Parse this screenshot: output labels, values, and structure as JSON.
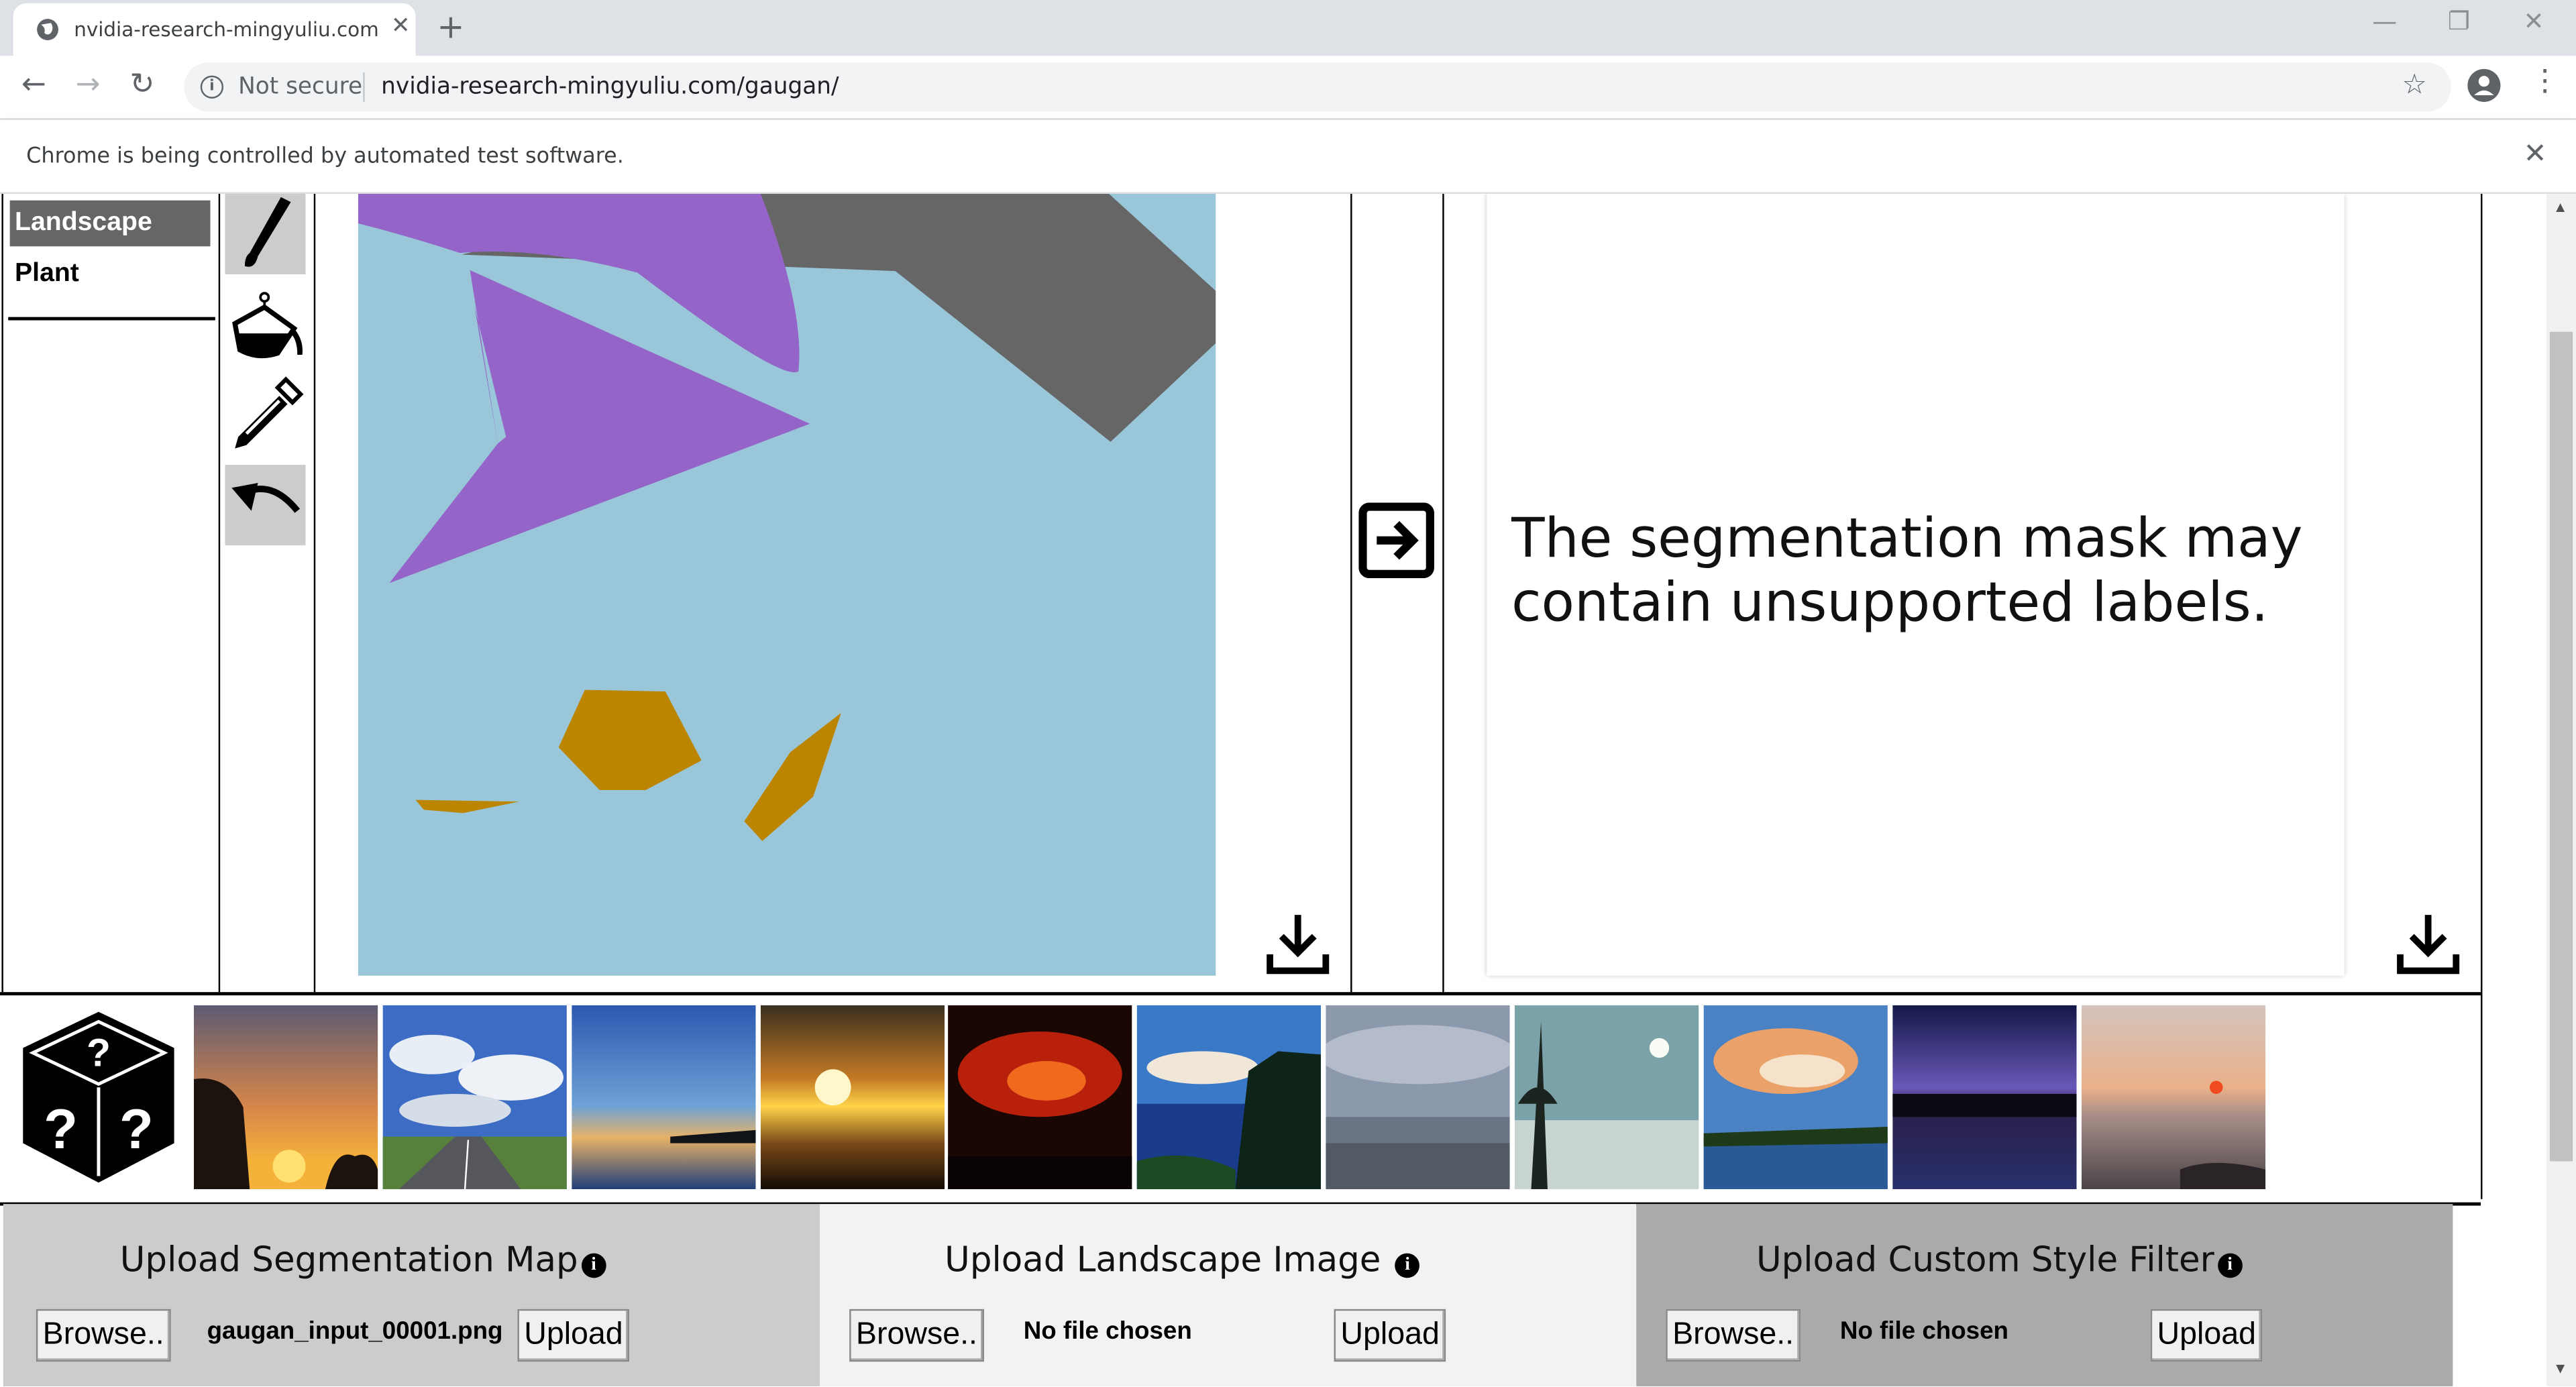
{
  "browser": {
    "tab_title": "nvidia-research-mingyuliu.com/g",
    "new_tab": "+",
    "tab_close": "✕",
    "security_label": "Not secure",
    "url": "nvidia-research-mingyuliu.com/gaugan/",
    "info_bar_message": "Chrome is being controlled by automated test software.",
    "info_bar_close": "✕"
  },
  "categories": [
    {
      "label": "Landscape",
      "active": true
    },
    {
      "label": "Plant",
      "active": false
    }
  ],
  "tools": [
    "brush-icon",
    "paint-bucket-icon",
    "eyedropper-icon",
    "undo-icon"
  ],
  "colors": {
    "sky": "#9ac6d9",
    "purple": "#9564c8",
    "gray": "#666666",
    "orange": "#bb8500"
  },
  "output": {
    "message": "The segmentation mask may contain unsupported labels."
  },
  "upload": {
    "segmentation": {
      "heading": "Upload Segmentation Map",
      "browse": "Browse..",
      "filename": "gaugan_input_00001.png",
      "upload": "Upload"
    },
    "landscape": {
      "heading": "Upload Landscape Image",
      "browse": "Browse..",
      "filename": "No file chosen",
      "upload": "Upload"
    },
    "style": {
      "heading": "Upload Custom Style Filter",
      "browse": "Browse..",
      "filename": "No file chosen",
      "upload": "Upload"
    }
  },
  "info_icon": "i",
  "style_thumbnails": [
    {
      "name": "sunset-trees"
    },
    {
      "name": "road-clouds"
    },
    {
      "name": "lake-dusk"
    },
    {
      "name": "sun-over-sea"
    },
    {
      "name": "red-sky"
    },
    {
      "name": "coastal-cliff"
    },
    {
      "name": "overcast-beach"
    },
    {
      "name": "snowy-shore"
    },
    {
      "name": "pink-clouds"
    },
    {
      "name": "purple-twilight"
    },
    {
      "name": "sunset-shore"
    }
  ]
}
